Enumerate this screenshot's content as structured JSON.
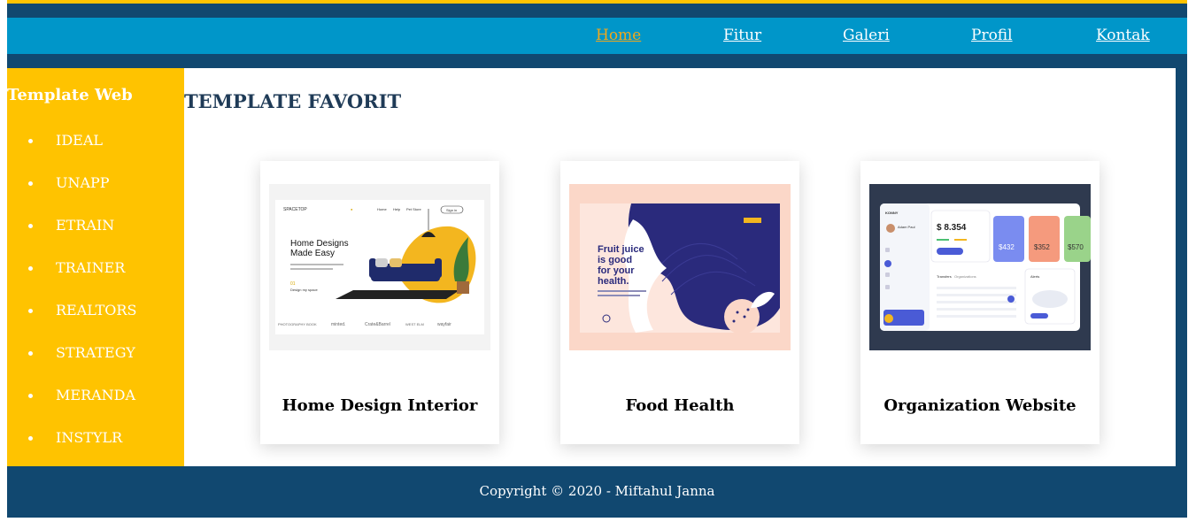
{
  "nav": {
    "items": [
      {
        "label": "Home",
        "active": true
      },
      {
        "label": "Fitur",
        "active": false
      },
      {
        "label": "Galeri",
        "active": false
      },
      {
        "label": "Profil",
        "active": false
      },
      {
        "label": "Kontak",
        "active": false
      }
    ]
  },
  "sidebar": {
    "title": "Template Web",
    "items": [
      "IDEAL",
      "UNAPP",
      "ETRAIN",
      "TRAINER",
      "REALTORS",
      "STRATEGY",
      "MERANDA",
      "INSTYLR"
    ]
  },
  "main": {
    "heading": "TEMPLATE FAVORIT",
    "cards": [
      {
        "title": "Home Design Interior",
        "preview": {
          "brand": "SPACETOP",
          "nav_items": [
            "Home",
            "Help",
            "Pet Store"
          ],
          "button": "Sign in",
          "headline_line1": "Home Designs",
          "headline_line2": "Made Easy",
          "stat_number": "01",
          "stat_label": "Design my space",
          "logos": [
            "PHOTOGRAPHY BOOK",
            "minted.",
            "Crate&Barrel",
            "WEST ELM",
            "wayfair"
          ]
        }
      },
      {
        "title": "Food Health",
        "preview": {
          "headline_line1": "Fruit juice",
          "headline_line2": "is good",
          "headline_line3": "for your",
          "headline_line4": "health."
        }
      },
      {
        "title": "Organization Website",
        "preview": {
          "brand": "KONNY",
          "user_name": "Adam Paul",
          "balance": "$ 8.354",
          "stat_1": "$432",
          "stat_2": "$352",
          "stat_3": "$570",
          "tab_1": "Transfers",
          "tab_2": "Organizations",
          "alerts_label": "Alerts"
        }
      }
    ]
  },
  "footer": {
    "text": "Copyright © 2020 - Miftahul Janna"
  },
  "colors": {
    "frame": "#114870",
    "top_stripe": "#ffc300",
    "navbar": "#0096c9",
    "active_link": "#f0a81c",
    "sidebar": "#ffc300",
    "heading": "#1f3b57"
  }
}
